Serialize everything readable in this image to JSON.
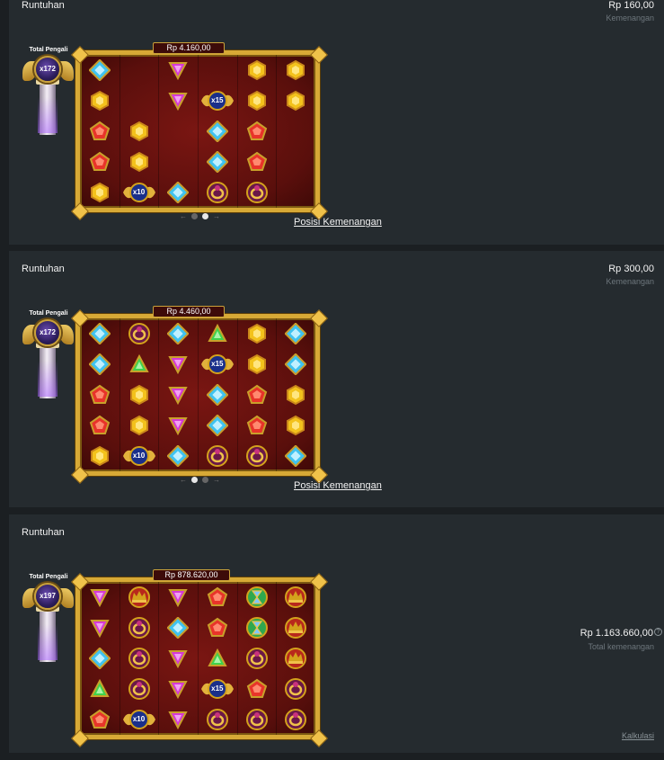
{
  "cards": [
    {
      "title": "Runtuhan",
      "amount": "Rp 160,00",
      "amount_label": "Kemenangan",
      "pillar_label": "Total Pengali",
      "pillar_multiplier": "x172",
      "board_win": "Rp 4.160,00",
      "link": "Posisi Kemenangan",
      "pager": {
        "prev": "←",
        "next": "→",
        "active_index": 1,
        "count": 2
      },
      "grid": [
        [
          "blue",
          "yellow",
          "red",
          "red",
          "yellow"
        ],
        [
          "empty",
          "empty",
          "yellow",
          "yellow",
          "mult:x10"
        ],
        [
          "purple",
          "purple",
          "empty",
          "empty",
          "blue"
        ],
        [
          "empty",
          "mult:x15",
          "blue",
          "blue",
          "ring"
        ],
        [
          "yellow",
          "yellow",
          "red",
          "red",
          "ring"
        ],
        [
          "yellow",
          "yellow",
          "empty",
          "empty",
          "empty"
        ]
      ]
    },
    {
      "title": "Runtuhan",
      "amount": "Rp 300,00",
      "amount_label": "Kemenangan",
      "pillar_label": "Total Pengali",
      "pillar_multiplier": "x172",
      "board_win": "Rp 4.460,00",
      "link": "Posisi Kemenangan",
      "pager": {
        "prev": "←",
        "next": "→",
        "active_index": 0,
        "count": 2
      },
      "grid": [
        [
          "blue",
          "blue",
          "red",
          "red",
          "yellow"
        ],
        [
          "ring",
          "green",
          "yellow",
          "yellow",
          "mult:x10"
        ],
        [
          "blue",
          "purple",
          "purple",
          "purple",
          "blue"
        ],
        [
          "green",
          "mult:x15",
          "blue",
          "blue",
          "ring"
        ],
        [
          "yellow",
          "yellow",
          "red",
          "red",
          "ring"
        ],
        [
          "blue",
          "blue",
          "yellow",
          "yellow",
          "blue"
        ]
      ]
    },
    {
      "title": "Runtuhan",
      "amount": "Rp 1.163.660,00",
      "amount_label": "Total kemenangan",
      "help": "?",
      "pillar_label": "Total Pengali",
      "pillar_multiplier": "x197",
      "board_win": "Rp 878.620,00",
      "link": "Kalkulasi",
      "grid": [
        [
          "purple",
          "purple",
          "blue",
          "green",
          "red"
        ],
        [
          "crown",
          "ring",
          "ring",
          "ring",
          "mult:x10"
        ],
        [
          "purple",
          "blue",
          "purple",
          "purple",
          "purple"
        ],
        [
          "red",
          "red",
          "green",
          "mult:x15",
          "ring"
        ],
        [
          "hourglass",
          "hourglass",
          "ring",
          "red",
          "ring"
        ],
        [
          "crown",
          "crown",
          "crown",
          "ring",
          "ring"
        ]
      ]
    }
  ],
  "colors": {
    "blue": "#3fc3f0",
    "yellow": "#f3c21c",
    "red": "#e8342a",
    "purple": "#d63ad6",
    "green": "#3fd34d",
    "ring": "#c8327d",
    "crown": "#d4a21c",
    "hourglass": "#2fa84f",
    "mult": "#1a2f8a"
  }
}
